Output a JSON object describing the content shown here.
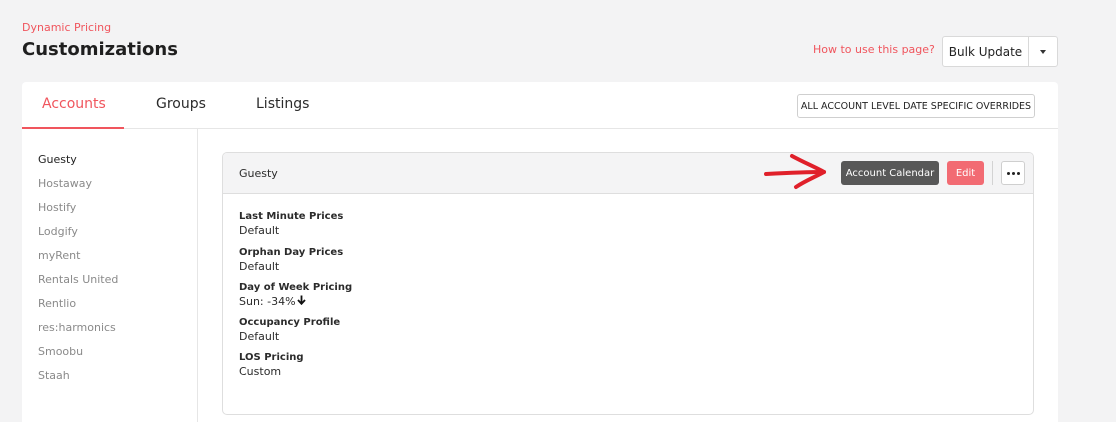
{
  "header": {
    "breadcrumb": "Dynamic Pricing",
    "title": "Customizations",
    "help_link": "How to use this page?",
    "bulk_update_label": "Bulk Update"
  },
  "tabs": [
    {
      "label": "Accounts",
      "active": true
    },
    {
      "label": "Groups",
      "active": false
    },
    {
      "label": "Listings",
      "active": false
    }
  ],
  "overrides_button": "ALL ACCOUNT LEVEL DATE SPECIFIC OVERRIDES",
  "sidebar": {
    "items": [
      {
        "label": "Guesty",
        "active": true
      },
      {
        "label": "Hostaway",
        "active": false
      },
      {
        "label": "Hostify",
        "active": false
      },
      {
        "label": "Lodgify",
        "active": false
      },
      {
        "label": "myRent",
        "active": false
      },
      {
        "label": "Rentals United",
        "active": false
      },
      {
        "label": "Rentlio",
        "active": false
      },
      {
        "label": "res:harmonics",
        "active": false
      },
      {
        "label": "Smoobu",
        "active": false
      },
      {
        "label": "Staah",
        "active": false
      }
    ]
  },
  "panel": {
    "title": "Guesty",
    "calendar_button": "Account Calendar",
    "edit_button": "Edit",
    "fields": [
      {
        "label": "Last Minute Prices",
        "value": "Default"
      },
      {
        "label": "Orphan Day Prices",
        "value": "Default"
      },
      {
        "label": "Day of Week Pricing",
        "value": "Sun: -34%"
      },
      {
        "label": "Occupancy Profile",
        "value": "Default"
      },
      {
        "label": "LOS Pricing",
        "value": "Custom"
      }
    ]
  },
  "icons": {
    "bulk_caret": "chevron-down-icon",
    "more": "ellipsis-icon",
    "dow_arrow": "arrow-down-icon",
    "annotation": "red-arrow-annotation"
  },
  "colors": {
    "accent": "#f0555d",
    "edit_button": "#f26b73",
    "calendar_button": "#585858",
    "annotation_arrow": "#e0202a"
  }
}
